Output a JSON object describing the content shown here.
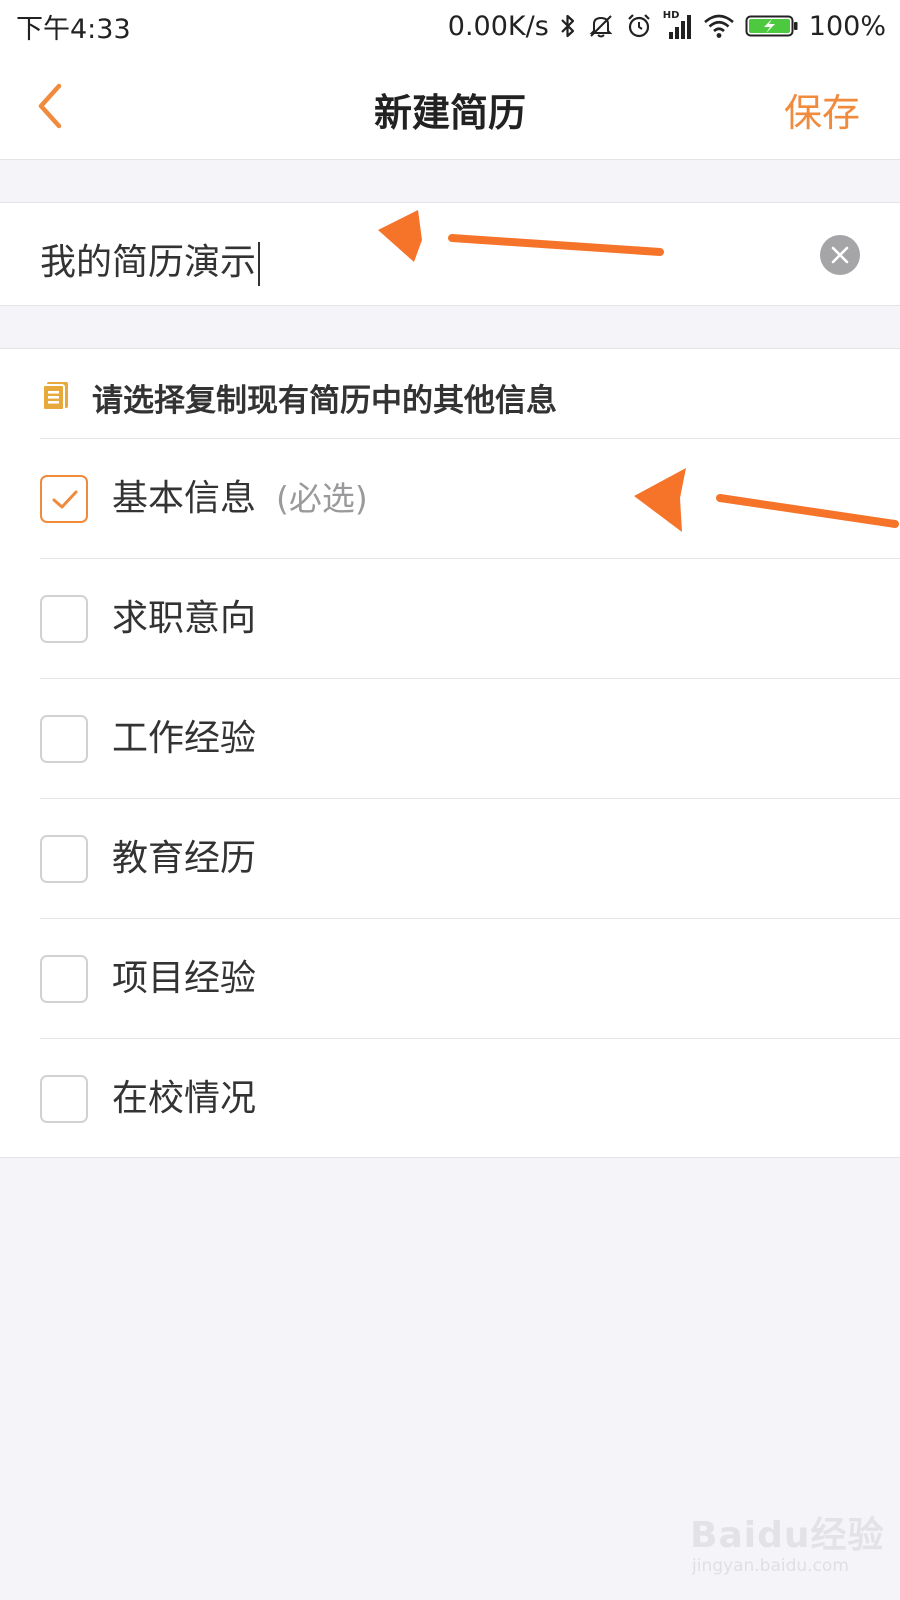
{
  "status_bar": {
    "time": "下午4:33",
    "net_speed": "0.00K/s",
    "signal_badge": "HD",
    "battery": "100%",
    "icons": [
      "bluetooth-icon",
      "mute-icon",
      "alarm-icon",
      "signal-icon",
      "wifi-icon",
      "battery-charging-icon"
    ]
  },
  "nav": {
    "back_icon": "chevron-left-icon",
    "title": "新建简历",
    "save_label": "保存"
  },
  "resume_name": {
    "value": "我的简历演示",
    "clear_icon": "clear-icon"
  },
  "copy_section": {
    "header_icon": "document-icon",
    "header": "请选择复制现有简历中的其他信息",
    "options": [
      {
        "label": "基本信息",
        "note": "(必选)",
        "checked": true
      },
      {
        "label": "求职意向",
        "note": "",
        "checked": false
      },
      {
        "label": "工作经验",
        "note": "",
        "checked": false
      },
      {
        "label": "教育经历",
        "note": "",
        "checked": false
      },
      {
        "label": "项目经验",
        "note": "",
        "checked": false
      },
      {
        "label": "在校情况",
        "note": "",
        "checked": false
      }
    ]
  },
  "watermark": {
    "brand": "Baidu经验",
    "url": "jingyan.baidu.com"
  },
  "colors": {
    "accent": "#f08a3c",
    "annotation_arrow": "#f5742a",
    "background": "#f5f4f8",
    "text": "#333333",
    "muted": "#9a9a9c",
    "header_icon": "#e8a93c"
  }
}
